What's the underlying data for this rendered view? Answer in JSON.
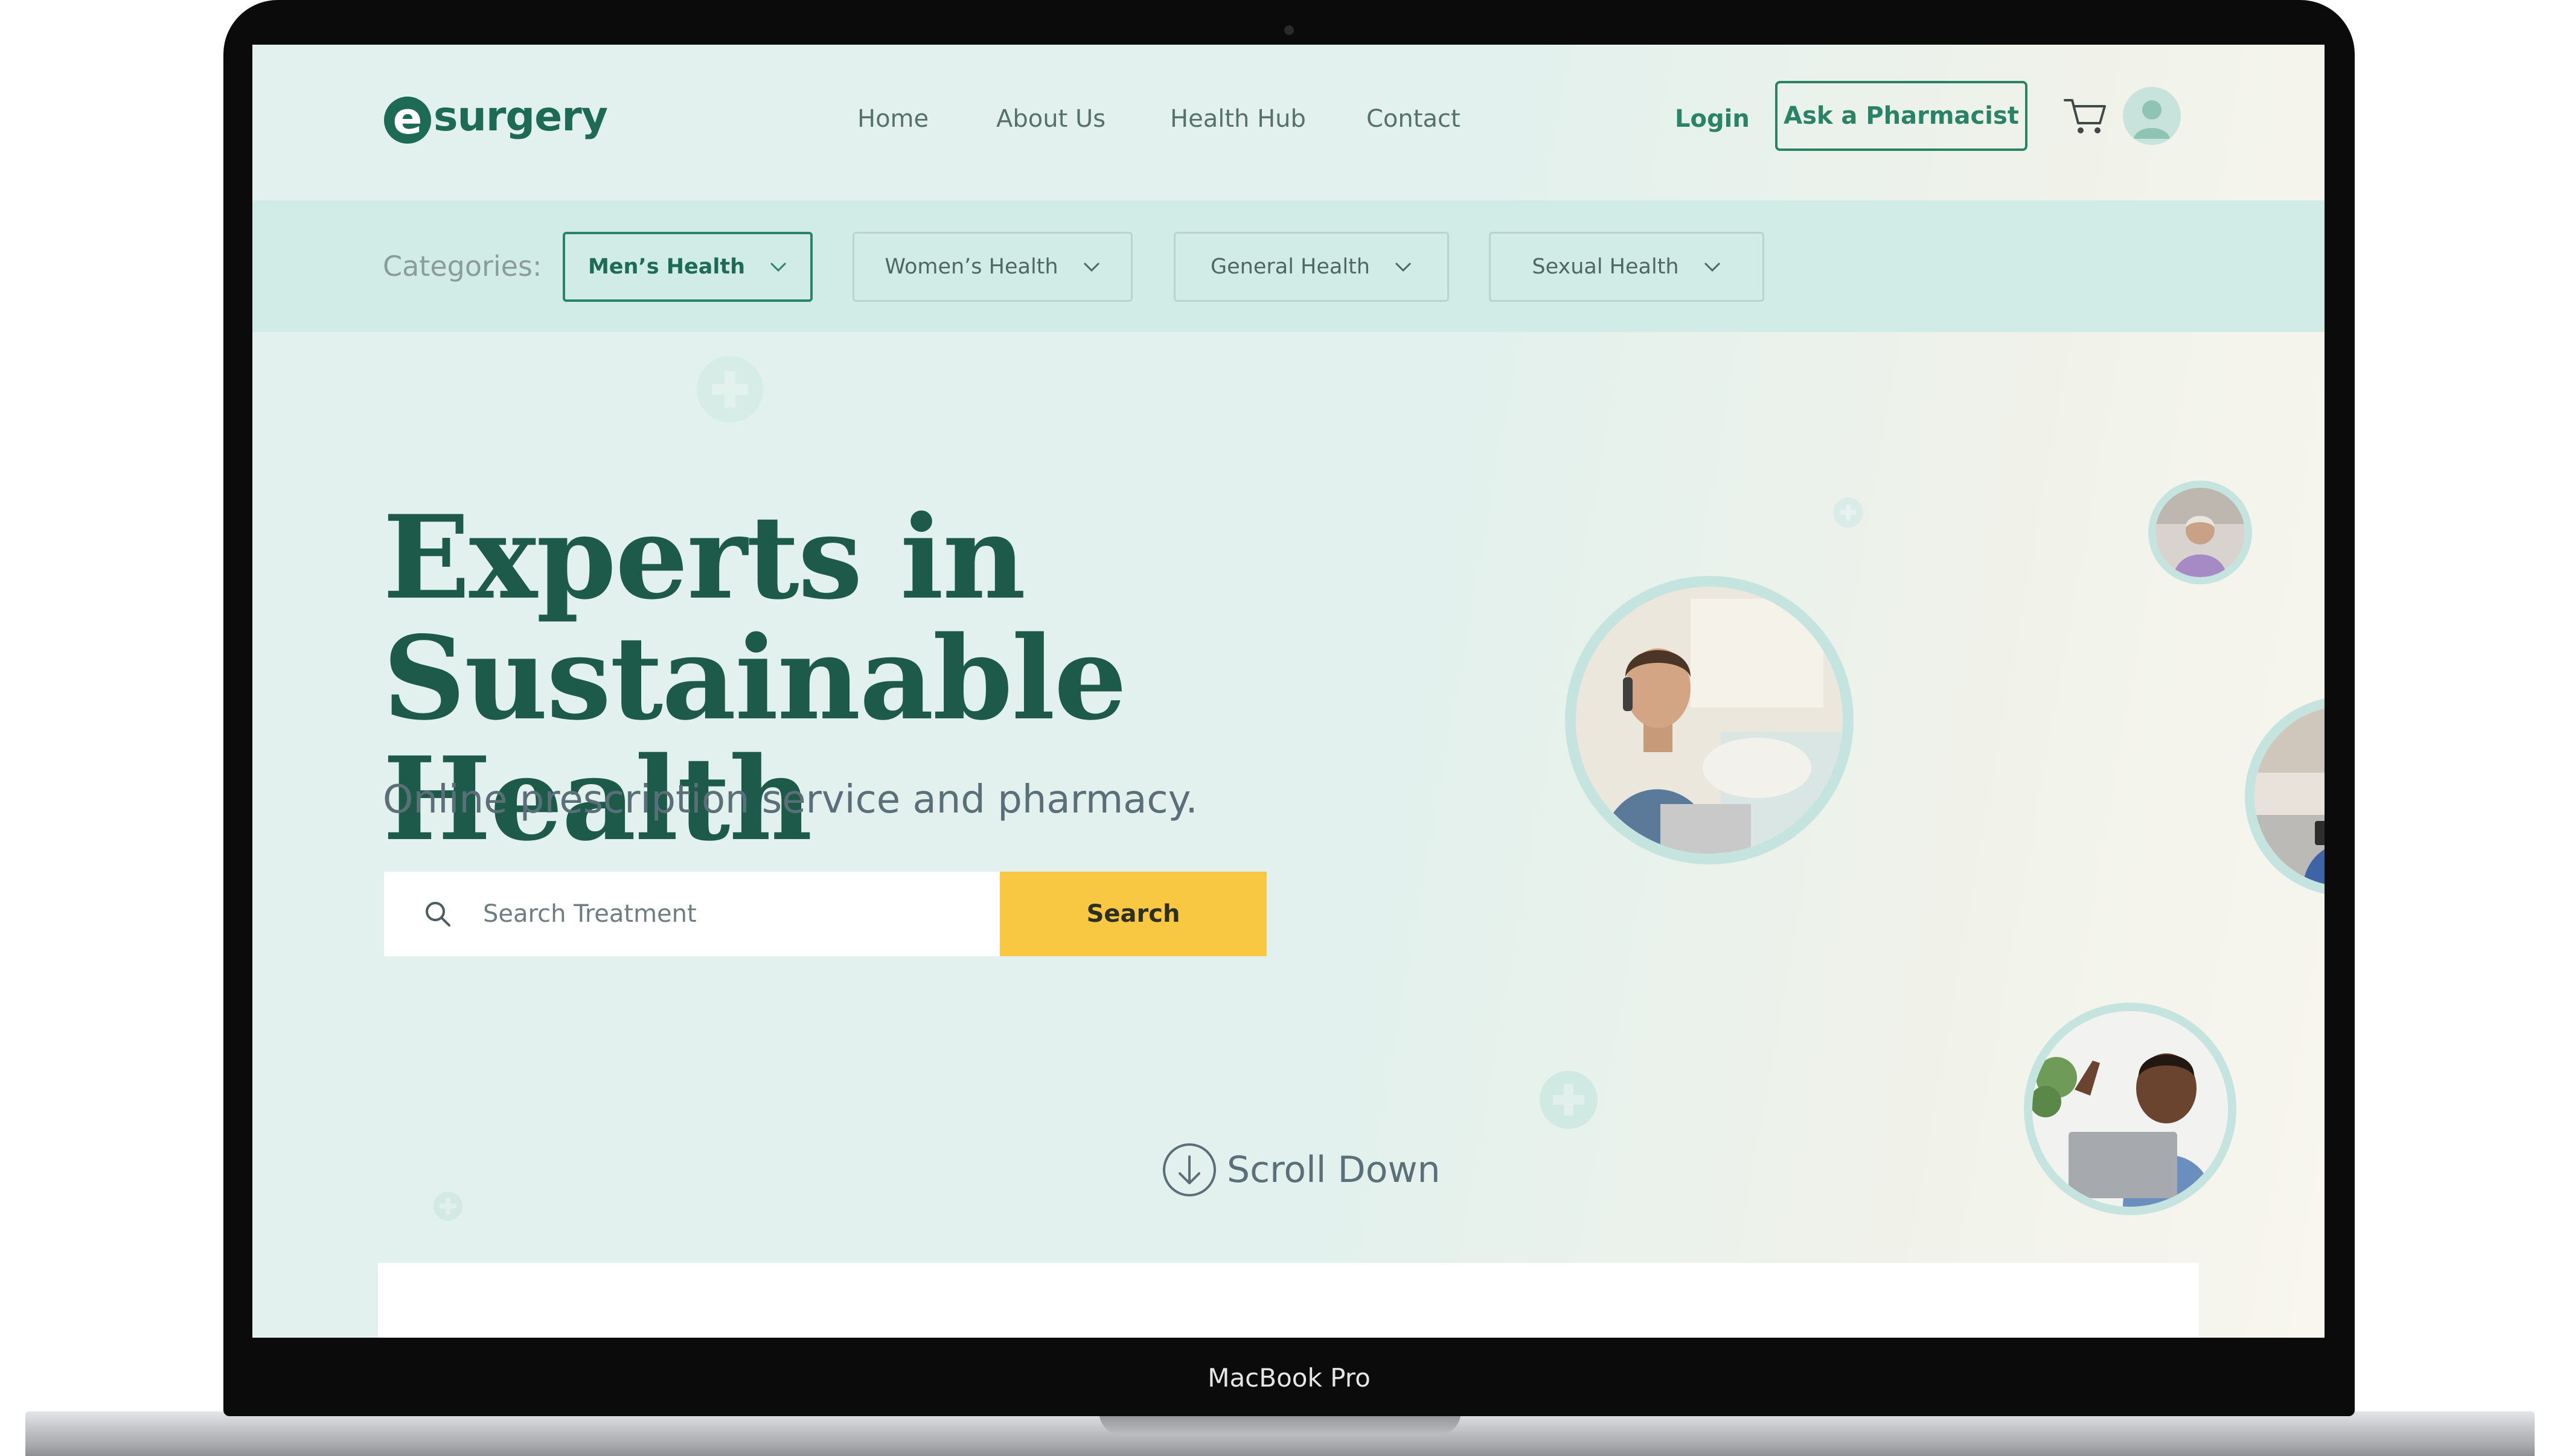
{
  "device": {
    "label": "MacBook Pro"
  },
  "logo": {
    "mark": "e",
    "text": "surgery"
  },
  "nav": {
    "links": [
      "Home",
      "About Us",
      "Health Hub",
      "Contact"
    ],
    "login": "Login",
    "ask_button": "Ask a Pharmacist"
  },
  "categories": {
    "label": "Categories:",
    "items": [
      {
        "label": "Men’s Health",
        "active": true
      },
      {
        "label": "Women’s Health",
        "active": false
      },
      {
        "label": "General Health",
        "active": false
      },
      {
        "label": "Sexual Health",
        "active": false
      }
    ]
  },
  "hero": {
    "title_line1": "Experts in",
    "title_line2": "Sustainable Health",
    "subtitle": "Online prescription service and pharmacy.",
    "search_placeholder": "Search Treatment",
    "search_button": "Search",
    "scroll_label": "Scroll Down"
  },
  "icons": [
    "search-icon",
    "cart-icon",
    "user-avatar-icon",
    "chevron-down-icon",
    "scroll-down-arrow-icon",
    "plus-decoration-icon"
  ],
  "colors": {
    "primary": "#1e6b55",
    "accent_yellow": "#f8c842",
    "background": "#e2f1ed",
    "category_bar": "#d1ebe6"
  }
}
